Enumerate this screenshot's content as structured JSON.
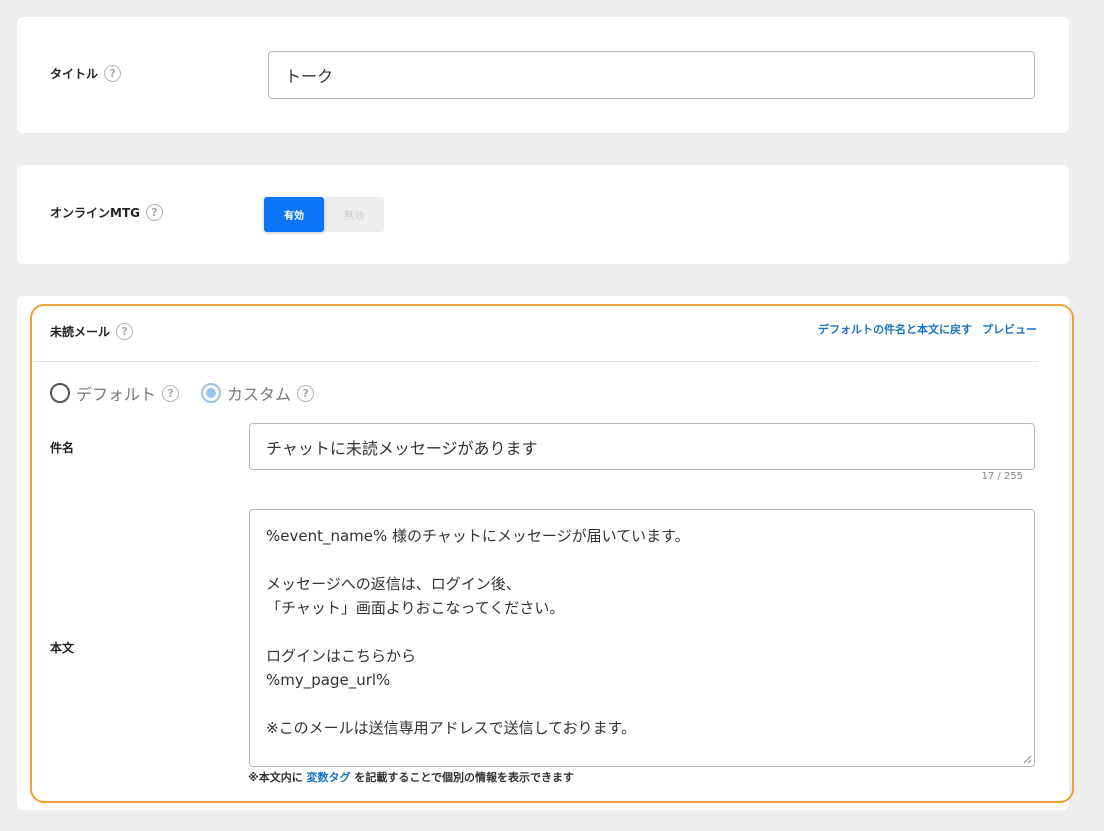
{
  "title_section": {
    "label": "タイトル",
    "value": "トーク"
  },
  "mtg_section": {
    "label": "オンラインMTG",
    "options": [
      "有効",
      "無効"
    ],
    "selected": "有効"
  },
  "mail_section": {
    "label": "未読メール",
    "links": {
      "reset": "デフォルトの件名と本文に戻す",
      "preview": "プレビュー"
    },
    "mode_options": {
      "default": "デフォルト",
      "custom": "カスタム"
    },
    "selected_mode": "カスタム",
    "subject_label": "件名",
    "subject_value": "チャットに未読メッセージがあります",
    "subject_counter": "17 / 255",
    "body_label": "本文",
    "body_lines": [
      "%event_name% 様のチャットにメッセージが届いています。",
      "",
      "メッセージへの返信は、ログイン後、",
      "「チャット」画面よりおこなってください。",
      "",
      "ログインはこちらから",
      "%my_page_url%",
      "",
      "※このメールは送信専用アドレスで送信しております。"
    ],
    "note_prefix": "※本文内に ",
    "note_link": "変数タグ",
    "note_suffix": " を記載することで個別の情報を表示できます"
  },
  "colors": {
    "accent": "#0a76f6",
    "link": "#1a74c2",
    "highlight": "#f0a03c"
  }
}
